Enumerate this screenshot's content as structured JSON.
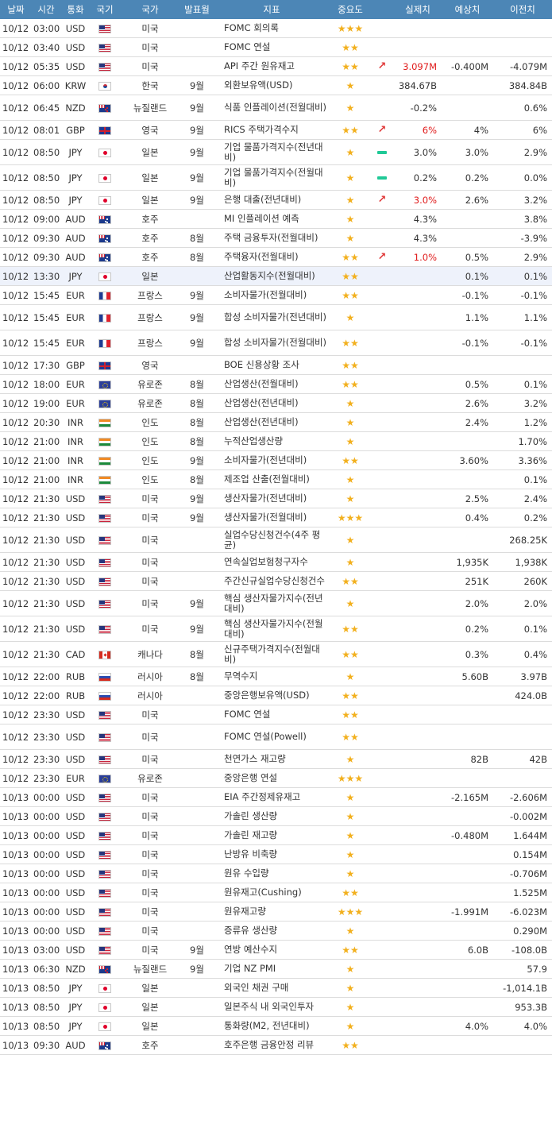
{
  "headers": [
    "날짜",
    "시간",
    "통화",
    "국기",
    "국가",
    "발표월",
    "지표",
    "중요도",
    "",
    "실제치",
    "예상치",
    "이전치"
  ],
  "rows": [
    {
      "date": "10/12",
      "time": "03:00",
      "currency": "USD",
      "flag": "us",
      "country": "미국",
      "period": "",
      "indicator": "FOMC 회의록",
      "stars": 3,
      "trend": "",
      "actual": "",
      "forecast": "",
      "previous": ""
    },
    {
      "date": "10/12",
      "time": "03:40",
      "currency": "USD",
      "flag": "us",
      "country": "미국",
      "period": "",
      "indicator": "FOMC 연설",
      "stars": 2,
      "trend": "",
      "actual": "",
      "forecast": "",
      "previous": ""
    },
    {
      "date": "10/12",
      "time": "05:35",
      "currency": "USD",
      "flag": "us",
      "country": "미국",
      "period": "",
      "indicator": "API 주간 원유재고",
      "stars": 2,
      "trend": "up",
      "actual": "3.097M",
      "forecast": "-0.400M",
      "previous": "-4.079M"
    },
    {
      "date": "10/12",
      "time": "06:00",
      "currency": "KRW",
      "flag": "kr",
      "country": "한국",
      "period": "9월",
      "indicator": "외환보유액(USD)",
      "stars": 1,
      "trend": "",
      "actual": "384.67B",
      "forecast": "",
      "previous": "384.84B"
    },
    {
      "date": "10/12",
      "time": "06:45",
      "currency": "NZD",
      "flag": "nz",
      "country": "뉴질랜드",
      "period": "9월",
      "indicator": "식품 인플레이션(전월대비)",
      "stars": 1,
      "trend": "",
      "actual": "-0.2%",
      "forecast": "",
      "previous": "0.6%"
    },
    {
      "date": "10/12",
      "time": "08:01",
      "currency": "GBP",
      "flag": "gb",
      "country": "영국",
      "period": "9월",
      "indicator": "RICS 주택가격수지",
      "stars": 2,
      "trend": "up",
      "actual": "6%",
      "forecast": "4%",
      "previous": "6%"
    },
    {
      "date": "10/12",
      "time": "08:50",
      "currency": "JPY",
      "flag": "jp",
      "country": "일본",
      "period": "9월",
      "indicator": "기업 물품가격지수(전년대비)",
      "stars": 1,
      "trend": "flat",
      "actual": "3.0%",
      "forecast": "3.0%",
      "previous": "2.9%"
    },
    {
      "date": "10/12",
      "time": "08:50",
      "currency": "JPY",
      "flag": "jp",
      "country": "일본",
      "period": "9월",
      "indicator": "기업 물품가격지수(전월대비)",
      "stars": 1,
      "trend": "flat",
      "actual": "0.2%",
      "forecast": "0.2%",
      "previous": "0.0%"
    },
    {
      "date": "10/12",
      "time": "08:50",
      "currency": "JPY",
      "flag": "jp",
      "country": "일본",
      "period": "9월",
      "indicator": "은행 대출(전년대비)",
      "stars": 1,
      "trend": "up",
      "actual": "3.0%",
      "forecast": "2.6%",
      "previous": "3.2%"
    },
    {
      "date": "10/12",
      "time": "09:00",
      "currency": "AUD",
      "flag": "au",
      "country": "호주",
      "period": "",
      "indicator": "MI 인플레이션 예측",
      "stars": 1,
      "trend": "",
      "actual": "4.3%",
      "forecast": "",
      "previous": "3.8%"
    },
    {
      "date": "10/12",
      "time": "09:30",
      "currency": "AUD",
      "flag": "au",
      "country": "호주",
      "period": "8월",
      "indicator": "주택 금융투자(전월대비)",
      "stars": 1,
      "trend": "",
      "actual": "4.3%",
      "forecast": "",
      "previous": "-3.9%"
    },
    {
      "date": "10/12",
      "time": "09:30",
      "currency": "AUD",
      "flag": "au",
      "country": "호주",
      "period": "8월",
      "indicator": "주택융자(전월대비)",
      "stars": 2,
      "trend": "up",
      "actual": "1.0%",
      "forecast": "0.5%",
      "previous": "2.9%"
    },
    {
      "date": "10/12",
      "time": "13:30",
      "currency": "JPY",
      "flag": "jp",
      "country": "일본",
      "period": "",
      "indicator": "산업활동지수(전월대비)",
      "stars": 2,
      "trend": "",
      "actual": "",
      "forecast": "0.1%",
      "previous": "0.1%",
      "highlight": true
    },
    {
      "date": "10/12",
      "time": "15:45",
      "currency": "EUR",
      "flag": "fr",
      "country": "프랑스",
      "period": "9월",
      "indicator": "소비자물가(전월대비)",
      "stars": 2,
      "trend": "",
      "actual": "",
      "forecast": "-0.1%",
      "previous": "-0.1%"
    },
    {
      "date": "10/12",
      "time": "15:45",
      "currency": "EUR",
      "flag": "fr",
      "country": "프랑스",
      "period": "9월",
      "indicator": "합성 소비자물가(전년대비)",
      "stars": 1,
      "trend": "",
      "actual": "",
      "forecast": "1.1%",
      "previous": "1.1%"
    },
    {
      "date": "10/12",
      "time": "15:45",
      "currency": "EUR",
      "flag": "fr",
      "country": "프랑스",
      "period": "9월",
      "indicator": "합성 소비자물가(전월대비)",
      "stars": 2,
      "trend": "",
      "actual": "",
      "forecast": "-0.1%",
      "previous": "-0.1%"
    },
    {
      "date": "10/12",
      "time": "17:30",
      "currency": "GBP",
      "flag": "gb",
      "country": "영국",
      "period": "",
      "indicator": "BOE 신용상황 조사",
      "stars": 2,
      "trend": "",
      "actual": "",
      "forecast": "",
      "previous": ""
    },
    {
      "date": "10/12",
      "time": "18:00",
      "currency": "EUR",
      "flag": "eu",
      "country": "유로존",
      "period": "8월",
      "indicator": "산업생산(전월대비)",
      "stars": 2,
      "trend": "",
      "actual": "",
      "forecast": "0.5%",
      "previous": "0.1%"
    },
    {
      "date": "10/12",
      "time": "19:00",
      "currency": "EUR",
      "flag": "eu",
      "country": "유로존",
      "period": "8월",
      "indicator": "산업생산(전년대비)",
      "stars": 1,
      "trend": "",
      "actual": "",
      "forecast": "2.6%",
      "previous": "3.2%"
    },
    {
      "date": "10/12",
      "time": "20:30",
      "currency": "INR",
      "flag": "in",
      "country": "인도",
      "period": "8월",
      "indicator": "산업생산(전년대비)",
      "stars": 1,
      "trend": "",
      "actual": "",
      "forecast": "2.4%",
      "previous": "1.2%"
    },
    {
      "date": "10/12",
      "time": "21:00",
      "currency": "INR",
      "flag": "in",
      "country": "인도",
      "period": "8월",
      "indicator": "누적산업생산량",
      "stars": 1,
      "trend": "",
      "actual": "",
      "forecast": "",
      "previous": "1.70%"
    },
    {
      "date": "10/12",
      "time": "21:00",
      "currency": "INR",
      "flag": "in",
      "country": "인도",
      "period": "9월",
      "indicator": "소비자물가(전년대비)",
      "stars": 2,
      "trend": "",
      "actual": "",
      "forecast": "3.60%",
      "previous": "3.36%"
    },
    {
      "date": "10/12",
      "time": "21:00",
      "currency": "INR",
      "flag": "in",
      "country": "인도",
      "period": "8월",
      "indicator": "제조업 산출(전월대비)",
      "stars": 1,
      "trend": "",
      "actual": "",
      "forecast": "",
      "previous": "0.1%"
    },
    {
      "date": "10/12",
      "time": "21:30",
      "currency": "USD",
      "flag": "us",
      "country": "미국",
      "period": "9월",
      "indicator": "생산자물가(전년대비)",
      "stars": 1,
      "trend": "",
      "actual": "",
      "forecast": "2.5%",
      "previous": "2.4%"
    },
    {
      "date": "10/12",
      "time": "21:30",
      "currency": "USD",
      "flag": "us",
      "country": "미국",
      "period": "9월",
      "indicator": "생산자물가(전월대비)",
      "stars": 3,
      "trend": "",
      "actual": "",
      "forecast": "0.4%",
      "previous": "0.2%"
    },
    {
      "date": "10/12",
      "time": "21:30",
      "currency": "USD",
      "flag": "us",
      "country": "미국",
      "period": "",
      "indicator": "실업수당신청건수(4주 평균)",
      "stars": 1,
      "trend": "",
      "actual": "",
      "forecast": "",
      "previous": "268.25K"
    },
    {
      "date": "10/12",
      "time": "21:30",
      "currency": "USD",
      "flag": "us",
      "country": "미국",
      "period": "",
      "indicator": "연속실업보험청구자수",
      "stars": 1,
      "trend": "",
      "actual": "",
      "forecast": "1,935K",
      "previous": "1,938K"
    },
    {
      "date": "10/12",
      "time": "21:30",
      "currency": "USD",
      "flag": "us",
      "country": "미국",
      "period": "",
      "indicator": "주간신규실업수당신청건수",
      "stars": 2,
      "trend": "",
      "actual": "",
      "forecast": "251K",
      "previous": "260K"
    },
    {
      "date": "10/12",
      "time": "21:30",
      "currency": "USD",
      "flag": "us",
      "country": "미국",
      "period": "9월",
      "indicator": "핵심 생산자물가지수(전년대비)",
      "stars": 1,
      "trend": "",
      "actual": "",
      "forecast": "2.0%",
      "previous": "2.0%"
    },
    {
      "date": "10/12",
      "time": "21:30",
      "currency": "USD",
      "flag": "us",
      "country": "미국",
      "period": "9월",
      "indicator": "핵심 생산자물가지수(전월대비)",
      "stars": 2,
      "trend": "",
      "actual": "",
      "forecast": "0.2%",
      "previous": "0.1%"
    },
    {
      "date": "10/12",
      "time": "21:30",
      "currency": "CAD",
      "flag": "ca",
      "country": "캐나다",
      "period": "8월",
      "indicator": "신규주택가격지수(전월대비)",
      "stars": 2,
      "trend": "",
      "actual": "",
      "forecast": "0.3%",
      "previous": "0.4%"
    },
    {
      "date": "10/12",
      "time": "22:00",
      "currency": "RUB",
      "flag": "ru",
      "country": "러시아",
      "period": "8월",
      "indicator": "무역수지",
      "stars": 1,
      "trend": "",
      "actual": "",
      "forecast": "5.60B",
      "previous": "3.97B"
    },
    {
      "date": "10/12",
      "time": "22:00",
      "currency": "RUB",
      "flag": "ru",
      "country": "러시아",
      "period": "",
      "indicator": "중앙은행보유액(USD)",
      "stars": 2,
      "trend": "",
      "actual": "",
      "forecast": "",
      "previous": "424.0B"
    },
    {
      "date": "10/12",
      "time": "23:30",
      "currency": "USD",
      "flag": "us",
      "country": "미국",
      "period": "",
      "indicator": "FOMC 연설",
      "stars": 2,
      "trend": "",
      "actual": "",
      "forecast": "",
      "previous": ""
    },
    {
      "date": "10/12",
      "time": "23:30",
      "currency": "USD",
      "flag": "us",
      "country": "미국",
      "period": "",
      "indicator": "FOMC 연설(Powell)",
      "stars": 2,
      "trend": "",
      "actual": "",
      "forecast": "",
      "previous": ""
    },
    {
      "date": "10/12",
      "time": "23:30",
      "currency": "USD",
      "flag": "us",
      "country": "미국",
      "period": "",
      "indicator": "천연가스 재고량",
      "stars": 1,
      "trend": "",
      "actual": "",
      "forecast": "82B",
      "previous": "42B"
    },
    {
      "date": "10/12",
      "time": "23:30",
      "currency": "EUR",
      "flag": "eu",
      "country": "유로존",
      "period": "",
      "indicator": "중앙은행 연설",
      "stars": 3,
      "trend": "",
      "actual": "",
      "forecast": "",
      "previous": ""
    },
    {
      "date": "10/13",
      "time": "00:00",
      "currency": "USD",
      "flag": "us",
      "country": "미국",
      "period": "",
      "indicator": "EIA 주간정제유재고",
      "stars": 1,
      "trend": "",
      "actual": "",
      "forecast": "-2.165M",
      "previous": "-2.606M"
    },
    {
      "date": "10/13",
      "time": "00:00",
      "currency": "USD",
      "flag": "us",
      "country": "미국",
      "period": "",
      "indicator": "가솔린 생산량",
      "stars": 1,
      "trend": "",
      "actual": "",
      "forecast": "",
      "previous": "-0.002M"
    },
    {
      "date": "10/13",
      "time": "00:00",
      "currency": "USD",
      "flag": "us",
      "country": "미국",
      "period": "",
      "indicator": "가솔린 재고량",
      "stars": 1,
      "trend": "",
      "actual": "",
      "forecast": "-0.480M",
      "previous": "1.644M"
    },
    {
      "date": "10/13",
      "time": "00:00",
      "currency": "USD",
      "flag": "us",
      "country": "미국",
      "period": "",
      "indicator": "난방유 비축량",
      "stars": 1,
      "trend": "",
      "actual": "",
      "forecast": "",
      "previous": "0.154M"
    },
    {
      "date": "10/13",
      "time": "00:00",
      "currency": "USD",
      "flag": "us",
      "country": "미국",
      "period": "",
      "indicator": "원유 수입량",
      "stars": 1,
      "trend": "",
      "actual": "",
      "forecast": "",
      "previous": "-0.706M"
    },
    {
      "date": "10/13",
      "time": "00:00",
      "currency": "USD",
      "flag": "us",
      "country": "미국",
      "period": "",
      "indicator": "원유재고(Cushing)",
      "stars": 2,
      "trend": "",
      "actual": "",
      "forecast": "",
      "previous": "1.525M"
    },
    {
      "date": "10/13",
      "time": "00:00",
      "currency": "USD",
      "flag": "us",
      "country": "미국",
      "period": "",
      "indicator": "원유재고량",
      "stars": 3,
      "trend": "",
      "actual": "",
      "forecast": "-1.991M",
      "previous": "-6.023M"
    },
    {
      "date": "10/13",
      "time": "00:00",
      "currency": "USD",
      "flag": "us",
      "country": "미국",
      "period": "",
      "indicator": "증류유 생산량",
      "stars": 1,
      "trend": "",
      "actual": "",
      "forecast": "",
      "previous": "0.290M"
    },
    {
      "date": "10/13",
      "time": "03:00",
      "currency": "USD",
      "flag": "us",
      "country": "미국",
      "period": "9월",
      "indicator": "연방 예산수지",
      "stars": 2,
      "trend": "",
      "actual": "",
      "forecast": "6.0B",
      "previous": "-108.0B"
    },
    {
      "date": "10/13",
      "time": "06:30",
      "currency": "NZD",
      "flag": "nz",
      "country": "뉴질랜드",
      "period": "9월",
      "indicator": "기업 NZ PMI",
      "stars": 1,
      "trend": "",
      "actual": "",
      "forecast": "",
      "previous": "57.9"
    },
    {
      "date": "10/13",
      "time": "08:50",
      "currency": "JPY",
      "flag": "jp",
      "country": "일본",
      "period": "",
      "indicator": "외국인 채권 구매",
      "stars": 1,
      "trend": "",
      "actual": "",
      "forecast": "",
      "previous": "-1,014.1B"
    },
    {
      "date": "10/13",
      "time": "08:50",
      "currency": "JPY",
      "flag": "jp",
      "country": "일본",
      "period": "",
      "indicator": "일본주식 내 외국인투자",
      "stars": 1,
      "trend": "",
      "actual": "",
      "forecast": "",
      "previous": "953.3B"
    },
    {
      "date": "10/13",
      "time": "08:50",
      "currency": "JPY",
      "flag": "jp",
      "country": "일본",
      "period": "",
      "indicator": "통화량(M2, 전년대비)",
      "stars": 1,
      "trend": "",
      "actual": "",
      "forecast": "4.0%",
      "previous": "4.0%"
    },
    {
      "date": "10/13",
      "time": "09:30",
      "currency": "AUD",
      "flag": "au",
      "country": "호주",
      "period": "",
      "indicator": "호주은행 금융안정 리뷰",
      "stars": 2,
      "trend": "",
      "actual": "",
      "forecast": "",
      "previous": ""
    }
  ]
}
